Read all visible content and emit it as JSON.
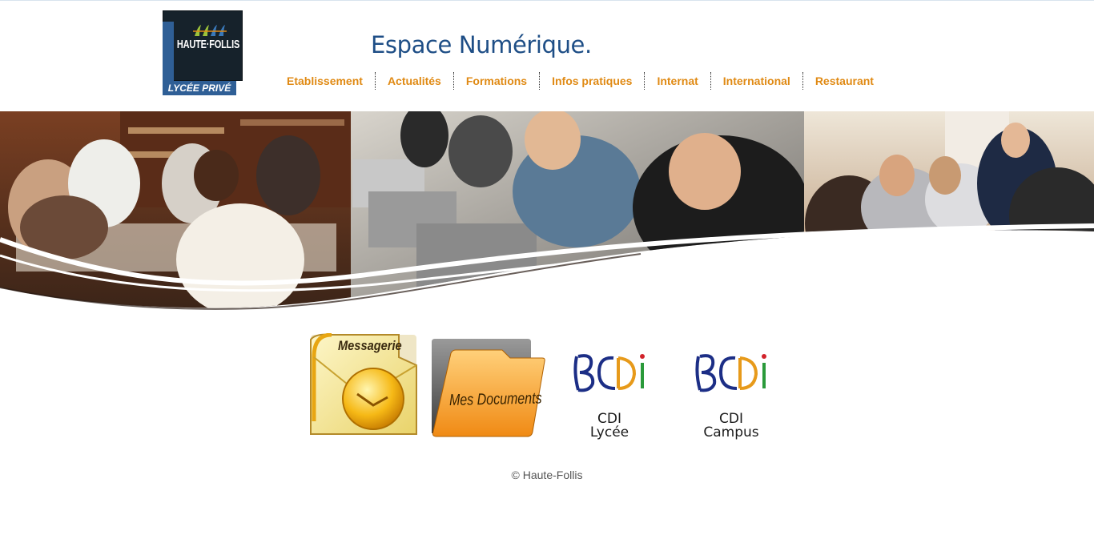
{
  "logo": {
    "name": "HAUTE·FOLLIS",
    "tagline": "LYCÉE PRIVÉ"
  },
  "header": {
    "title": "Espace Numérique."
  },
  "nav": {
    "items": [
      {
        "label": "Etablissement"
      },
      {
        "label": "Actualités"
      },
      {
        "label": "Formations"
      },
      {
        "label": "Infos pratiques"
      },
      {
        "label": "Internat"
      },
      {
        "label": "International"
      },
      {
        "label": "Restaurant"
      }
    ]
  },
  "apps": {
    "mail": {
      "label": "Messagerie",
      "icon": "envelope-icon"
    },
    "docs": {
      "label": "Mes Documents",
      "icon": "folder-icon"
    },
    "cdi_lycee": {
      "logo": "BCDI",
      "line1": "CDI",
      "line2": "Lycée"
    },
    "cdi_campus": {
      "logo": "BCDI",
      "line1": "CDI",
      "line2": "Campus"
    }
  },
  "footer": {
    "copyright": "© Haute-Follis"
  },
  "colors": {
    "nav": "#e08a14",
    "title": "#1e4e86",
    "logo_blue": "#2f5f96",
    "logo_dark": "#16222b"
  }
}
